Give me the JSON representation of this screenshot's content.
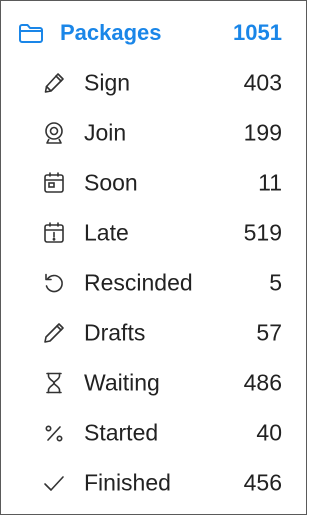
{
  "header": {
    "icon": "folder-icon",
    "label": "Packages",
    "count": "1051",
    "accent": "#1a86e8"
  },
  "items": [
    {
      "icon": "pen-icon",
      "label": "Sign",
      "count": "403"
    },
    {
      "icon": "webcam-icon",
      "label": "Join",
      "count": "199"
    },
    {
      "icon": "calendar-icon",
      "label": "Soon",
      "count": "11"
    },
    {
      "icon": "calendar-alert-icon",
      "label": "Late",
      "count": "519"
    },
    {
      "icon": "undo-icon",
      "label": "Rescinded",
      "count": "5"
    },
    {
      "icon": "pencil-icon",
      "label": "Drafts",
      "count": "57"
    },
    {
      "icon": "hourglass-icon",
      "label": "Waiting",
      "count": "486"
    },
    {
      "icon": "percent-icon",
      "label": "Started",
      "count": "40"
    },
    {
      "icon": "checkmark-icon",
      "label": "Finished",
      "count": "456"
    }
  ]
}
